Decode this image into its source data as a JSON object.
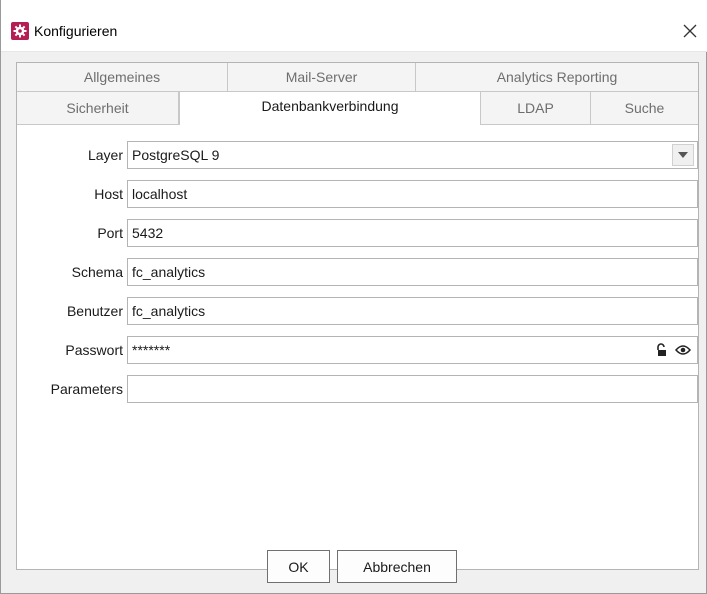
{
  "window": {
    "title": "Konfigurieren",
    "close_glyph": "✕",
    "icon": "gear-icon",
    "icon_color": "#b51e54"
  },
  "tabs": {
    "row1": [
      {
        "label": "Allgemeines"
      },
      {
        "label": "Mail-Server"
      },
      {
        "label": "Analytics Reporting"
      }
    ],
    "row2": [
      {
        "label": "Sicherheit"
      },
      {
        "label": "Datenbankverbindung",
        "active": true
      },
      {
        "label": "LDAP"
      },
      {
        "label": "Suche"
      }
    ]
  },
  "form": {
    "layer": {
      "label": "Layer",
      "value": "PostgreSQL 9"
    },
    "host": {
      "label": "Host",
      "value": "localhost"
    },
    "port": {
      "label": "Port",
      "value": "5432"
    },
    "schema": {
      "label": "Schema",
      "value": "fc_analytics"
    },
    "user": {
      "label": "Benutzer",
      "value": "fc_analytics"
    },
    "password": {
      "label": "Passwort",
      "value": "*******"
    },
    "parameters": {
      "label": "Parameters",
      "value": ""
    }
  },
  "buttons": {
    "ok": "OK",
    "cancel": "Abbrechen"
  }
}
